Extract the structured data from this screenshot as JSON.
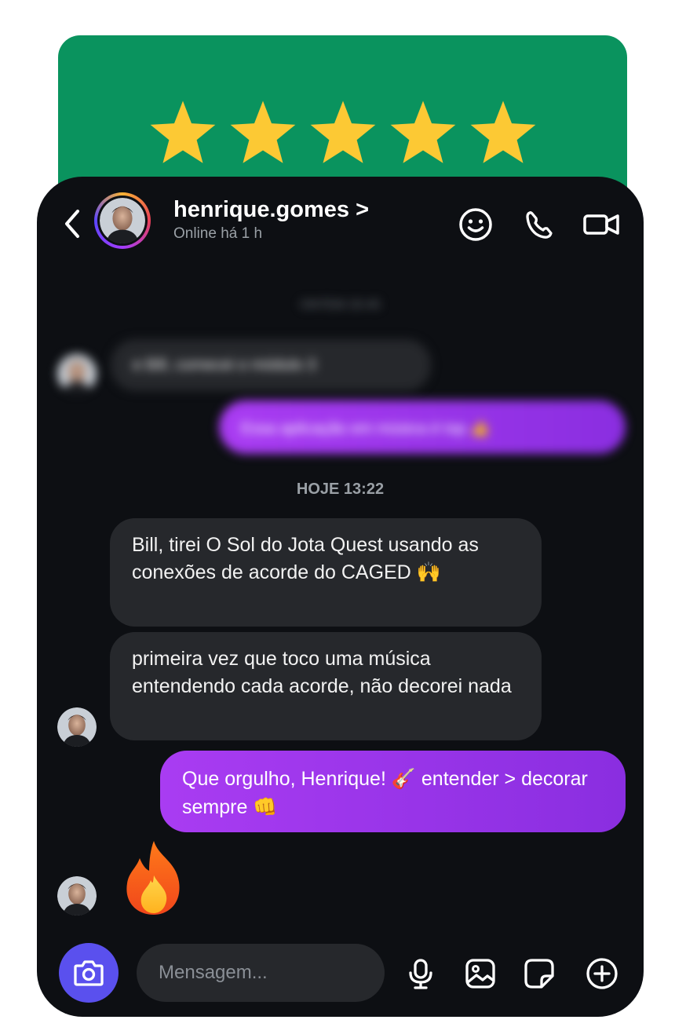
{
  "rating": {
    "value": 5,
    "max": 5,
    "star_color": "#fcc934",
    "card_color": "#0a935e"
  },
  "header": {
    "username": "henrique.gomes",
    "chevron": ">",
    "status": "Online há 1 h",
    "icons": [
      "back-chevron-icon",
      "emoji-face-icon",
      "phone-icon",
      "video-camera-icon"
    ]
  },
  "chat": {
    "earlier_date": "ONTEM 20:45",
    "earlier_incoming": "e Bill, comecei o módulo 3",
    "earlier_outgoing": "Essa aplicação em música é top 👍",
    "today_date": "HOJE 13:22",
    "incoming_1": "Bill, tirei O Sol do Jota Quest usando as conexões de acorde do CAGED 🙌",
    "incoming_2": "primeira vez que toco uma música entendendo cada acorde, não decorei nada",
    "outgoing_1": "Que orgulho, Henrique! 🎸 entender > decorar sempre 👊",
    "reaction": "fire"
  },
  "composer": {
    "placeholder": "Mensagem...",
    "icons": [
      "camera-icon",
      "microphone-icon",
      "gallery-icon",
      "sticker-icon",
      "plus-icon"
    ]
  },
  "colors": {
    "background": "#0d0f13",
    "bubble_in": "#26282c",
    "bubble_out": "#a93cf2",
    "accent": "#5a50ee"
  }
}
